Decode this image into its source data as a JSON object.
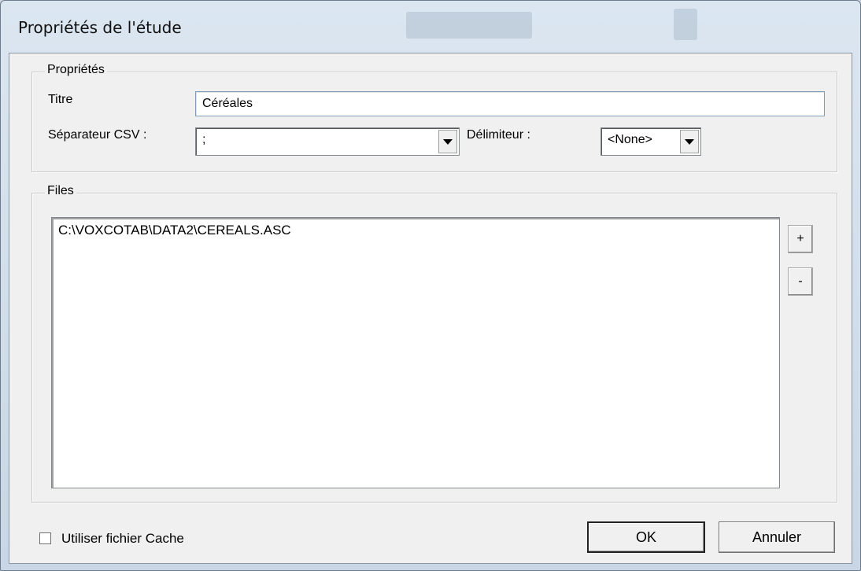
{
  "window": {
    "title": "Propriétés de l'étude"
  },
  "properties_group": {
    "legend": "Propriétés",
    "title_label": "Titre",
    "title_value": "Céréales",
    "csv_separator_label": "Séparateur CSV :",
    "csv_separator_value": ";",
    "delimiter_label": "Délimiteur :",
    "delimiter_value": "<None>"
  },
  "files_group": {
    "legend": "Files",
    "files": [
      "C:\\VOXCOTAB\\DATA2\\CEREALS.ASC"
    ],
    "add_label": "+",
    "remove_label": "-"
  },
  "footer": {
    "use_cache_label": "Utiliser fichier Cache",
    "use_cache_checked": false,
    "ok_label": "OK",
    "cancel_label": "Annuler"
  }
}
